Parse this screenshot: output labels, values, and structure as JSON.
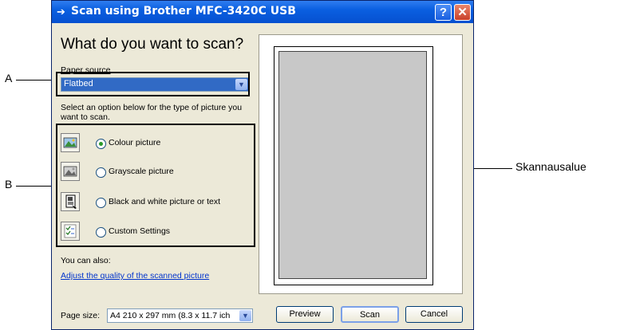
{
  "window": {
    "title": "Scan using Brother MFC-3420C USB",
    "help_label": "?",
    "close_label": "✕"
  },
  "dialog": {
    "heading": "What do you want to scan?",
    "paper_source_label": "Paper source",
    "paper_source_value": "Flatbed",
    "instruction": "Select an option below for the type of picture you want to scan.",
    "options": [
      {
        "label": "Colour picture",
        "selected": true,
        "icon": "colour-photo-icon"
      },
      {
        "label": "Grayscale picture",
        "selected": false,
        "icon": "grayscale-photo-icon"
      },
      {
        "label": "Black and white picture or text",
        "selected": false,
        "icon": "document-text-icon"
      },
      {
        "label": "Custom Settings",
        "selected": false,
        "icon": "custom-settings-icon"
      }
    ],
    "also_label": "You can also:",
    "adjust_link": "Adjust the quality of the scanned picture",
    "page_size_label": "Page size:",
    "page_size_value": "A4 210 x 297 mm (8.3 x 11.7 ich",
    "buttons": {
      "preview": "Preview",
      "scan": "Scan",
      "cancel": "Cancel"
    }
  },
  "callouts": {
    "a": "A",
    "b": "B",
    "scan_area": "Skannausalue"
  }
}
